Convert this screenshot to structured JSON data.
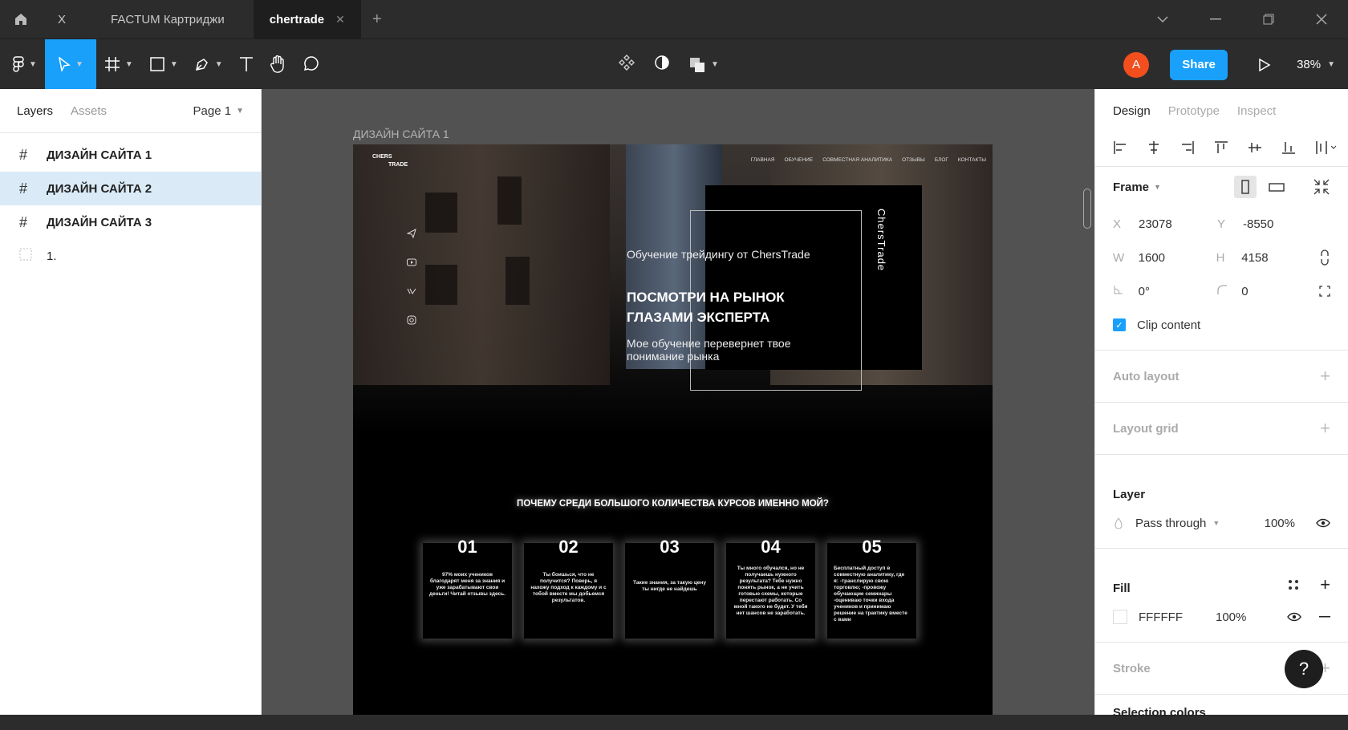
{
  "titlebar": {
    "tabs": [
      {
        "label": "X"
      },
      {
        "label": "FACTUM Картриджи"
      },
      {
        "label": "chertrade"
      }
    ]
  },
  "toolbar": {
    "share_label": "Share",
    "avatar_initial": "A",
    "zoom": "38%"
  },
  "left": {
    "tabs": [
      "Layers",
      "Assets"
    ],
    "page": "Page 1",
    "layers": [
      "ДИЗАЙН САЙТА 1",
      "ДИЗАЙН САЙТА 2",
      "ДИЗАЙН САЙТА 3",
      "1."
    ]
  },
  "canvas": {
    "frame_label": "ДИЗАЙН САЙТА 1",
    "logo_line1": "CHERS",
    "logo_line2": "TRADE",
    "nav": [
      "ГЛАВНАЯ",
      "ОБУЧЕНИЕ",
      "СОВМЕСТНАЯ АНАЛИТИКА",
      "ОТЗЫВЫ",
      "БЛОГ",
      "КОНТАКТЫ"
    ],
    "vertical_text": "ChersTrade",
    "hero_sub": "Обучение трейдингу от ChersTrade",
    "hero_title": "ПОСМОТРИ НА РЫНОК ГЛАЗАМИ ЭКСПЕРТА",
    "hero_desc": "Мое обучение перевернет твое понимание рынка",
    "why": "ПОЧЕМУ СРЕДИ БОЛЬШОГО КОЛИЧЕСТВА КУРСОВ ИМЕННО МОЙ?",
    "cards": [
      {
        "num": "01",
        "text": "97% моих учеников благодарят меня за знания и уже зарабатывают свои деньги! Читай отзывы здесь."
      },
      {
        "num": "02",
        "text": "Ты боишься, что не получится? Поверь, я нахожу подход к каждому и с тобой вместе мы добьемся результатов."
      },
      {
        "num": "03",
        "text": "Такие знания, за такую цену ты нигде не найдешь"
      },
      {
        "num": "04",
        "text": "Ты много обучался, но не получаешь нужного результата? Тебе нужно понять рынок, а не учить готовые схемы, которые перестают работать. Со мной такого не будет. У тебя нет шансов не заработать."
      },
      {
        "num": "05",
        "text": "Бесплатный доступ в совместную аналитику, где я: -транслирую свою торговлю; -провожу обучающие семинары -оцениваю точки входа учеников и принимаю решение на трактику вместе с вами"
      }
    ]
  },
  "right": {
    "tabs": [
      "Design",
      "Prototype",
      "Inspect"
    ],
    "frame_title": "Frame",
    "x_label": "X",
    "x": "23078",
    "y_label": "Y",
    "y": "-8550",
    "w_label": "W",
    "w": "1600",
    "h_label": "H",
    "h": "4158",
    "rotation": "0°",
    "radius": "0",
    "clip_label": "Clip content",
    "auto_layout": "Auto layout",
    "layout_grid": "Layout grid",
    "layer_title": "Layer",
    "blend": "Pass through",
    "opacity": "100%",
    "fill_title": "Fill",
    "fill_hex": "FFFFFF",
    "fill_opacity": "100%",
    "stroke_title": "Stroke",
    "selection_colors": "Selection colors"
  },
  "colors": {
    "accent": "#18a0fb",
    "avatar": "#f24e1e",
    "dark": "#2c2c2c",
    "canvas": "#525252"
  },
  "help_label": "?"
}
